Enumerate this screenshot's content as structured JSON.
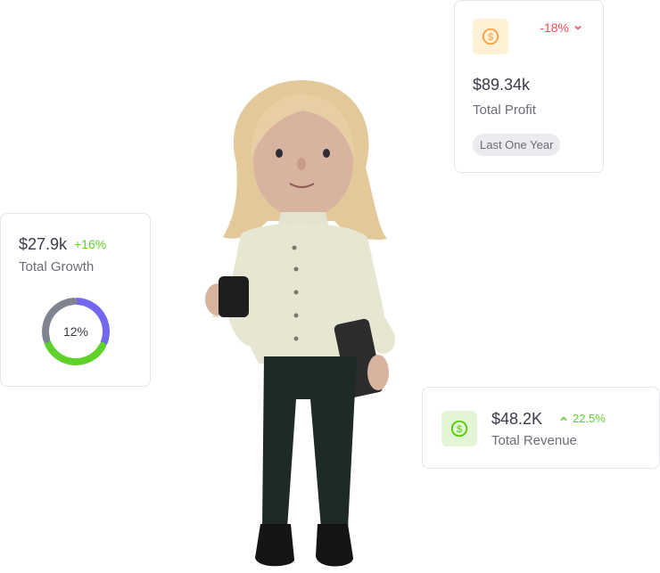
{
  "profit_card": {
    "change": "-18%",
    "change_icon": "chevron-down-icon",
    "amount": "$89.34k",
    "label": "Total Profit",
    "period_chip": "Last One Year",
    "icon": "dollar-coin-icon",
    "accent": "#ff9f43",
    "change_color": "#ff4c51"
  },
  "growth_card": {
    "amount": "$27.9k",
    "change": "+16%",
    "label": "Total Growth",
    "ring_label": "12%",
    "ring_segments": [
      {
        "color": "#7367f0",
        "fraction": 0.32
      },
      {
        "color": "#5ed12a",
        "fraction": 0.38
      },
      {
        "color": "#808390",
        "fraction": 0.3
      }
    ]
  },
  "revenue_card": {
    "amount": "$48.2K",
    "change": "22.5%",
    "change_icon": "chevron-up-icon",
    "label": "Total Revenue",
    "icon": "dollar-coin-icon",
    "accent": "#56ca00"
  }
}
